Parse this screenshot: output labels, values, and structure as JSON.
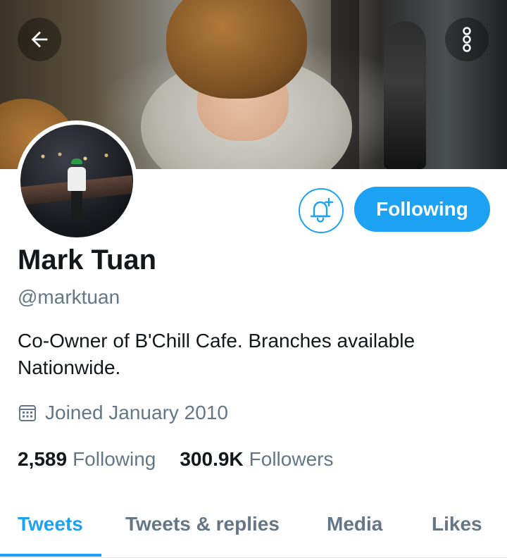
{
  "header": {
    "back_icon": "arrow-left-icon",
    "more_icon": "more-vertical-icon"
  },
  "profile": {
    "name": "Mark Tuan",
    "handle": "@marktuan",
    "bio": "Co-Owner of B'Chill Cafe. Branches available Nationwide.",
    "joined": "Joined January 2010",
    "following_count": "2,589",
    "following_label": "Following",
    "followers_count": "300.9K",
    "followers_label": "Followers"
  },
  "actions": {
    "notify_icon": "bell-plus-icon",
    "following_button": "Following"
  },
  "tabs": [
    {
      "label": "Tweets",
      "active": true
    },
    {
      "label": "Tweets & replies",
      "active": false
    },
    {
      "label": "Media",
      "active": false
    },
    {
      "label": "Likes",
      "active": false
    }
  ],
  "colors": {
    "accent": "#1da1f2",
    "text_primary": "#14171a",
    "text_secondary": "#657786"
  }
}
